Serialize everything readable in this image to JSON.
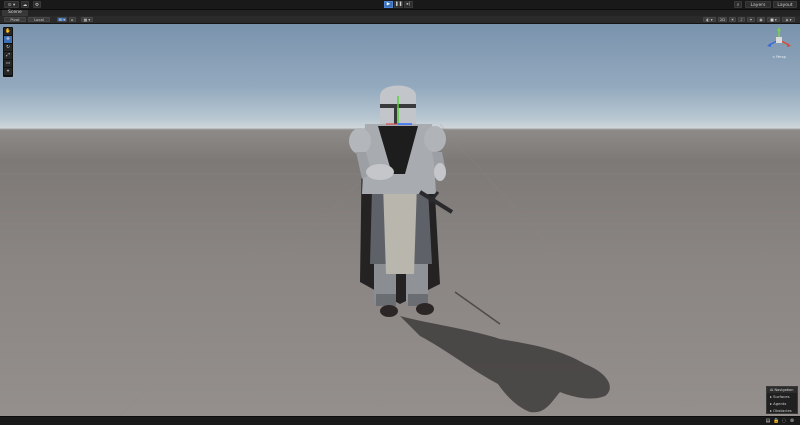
{
  "toolbar": {
    "account_label": "⊙ ▾",
    "cloud_icon": "cloud-icon",
    "layers_label": "Layers",
    "layout_label": "Layout",
    "search_icon": "search-icon",
    "play_icons": [
      "play-icon",
      "pause-icon",
      "step-icon"
    ]
  },
  "tabs": [
    {
      "label": "Scene"
    }
  ],
  "scene_toolbar": {
    "pivot_label": "Pivot",
    "space_label": "Local",
    "grid_label": "⊞ ▾",
    "snap_label": "▸",
    "shading_label": "◐ ▾",
    "mode_2d_label": "2D"
  },
  "tools": [
    {
      "name": "hand-tool-icon",
      "glyph": "✋"
    },
    {
      "name": "move-tool-icon",
      "glyph": "✥"
    },
    {
      "name": "rotate-tool-icon",
      "glyph": "↻"
    },
    {
      "name": "scale-tool-icon",
      "glyph": "⤢"
    },
    {
      "name": "rect-tool-icon",
      "glyph": "▭"
    },
    {
      "name": "transform-tool-icon",
      "glyph": "⌖"
    }
  ],
  "gizmo": {
    "label": "< Persp"
  },
  "ai_navigation": {
    "title": "AI Navigation",
    "items": [
      "Surfaces",
      "Agents",
      "Obstacles"
    ]
  },
  "status_icons": [
    "console-icon",
    "lock-icon",
    "light-icon",
    "network-icon"
  ],
  "colors": {
    "accent": "#3d6fb6",
    "sky_top": "#7a93ad",
    "ground": "#8a8583"
  }
}
